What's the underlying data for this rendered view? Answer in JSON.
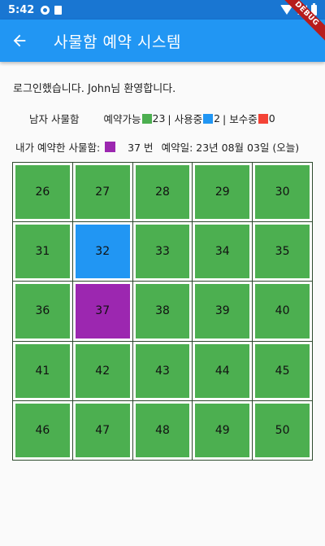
{
  "status_bar": {
    "time": "5:42"
  },
  "app_bar": {
    "title": "사물함 예약 시스템"
  },
  "debug_label": "DEBUG",
  "welcome": "로그인했습니다. John님 환영합니다.",
  "summary": {
    "zone": "남자 사물함",
    "available_label": "예약가능",
    "available_count": "23",
    "in_use_label": "| 사용중",
    "in_use_count": "2",
    "maintenance_label": "| 보수중",
    "maintenance_count": "0"
  },
  "my_reservation": {
    "label": "내가 예약한 사물함:",
    "number": "37 번",
    "date": "예약일: 23년 08월 03일 (오늘)"
  },
  "colors": {
    "available": "#4caf50",
    "in_use": "#2196f3",
    "maintenance": "#f44336",
    "mine": "#9c27b0"
  },
  "lockers": [
    {
      "num": "26",
      "status": "available"
    },
    {
      "num": "27",
      "status": "available"
    },
    {
      "num": "28",
      "status": "available"
    },
    {
      "num": "29",
      "status": "available"
    },
    {
      "num": "30",
      "status": "available"
    },
    {
      "num": "31",
      "status": "available"
    },
    {
      "num": "32",
      "status": "in_use"
    },
    {
      "num": "33",
      "status": "available"
    },
    {
      "num": "34",
      "status": "available"
    },
    {
      "num": "35",
      "status": "available"
    },
    {
      "num": "36",
      "status": "available"
    },
    {
      "num": "37",
      "status": "mine"
    },
    {
      "num": "38",
      "status": "available"
    },
    {
      "num": "39",
      "status": "available"
    },
    {
      "num": "40",
      "status": "available"
    },
    {
      "num": "41",
      "status": "available"
    },
    {
      "num": "42",
      "status": "available"
    },
    {
      "num": "43",
      "status": "available"
    },
    {
      "num": "44",
      "status": "available"
    },
    {
      "num": "45",
      "status": "available"
    },
    {
      "num": "46",
      "status": "available"
    },
    {
      "num": "47",
      "status": "available"
    },
    {
      "num": "48",
      "status": "available"
    },
    {
      "num": "49",
      "status": "available"
    },
    {
      "num": "50",
      "status": "available"
    }
  ]
}
